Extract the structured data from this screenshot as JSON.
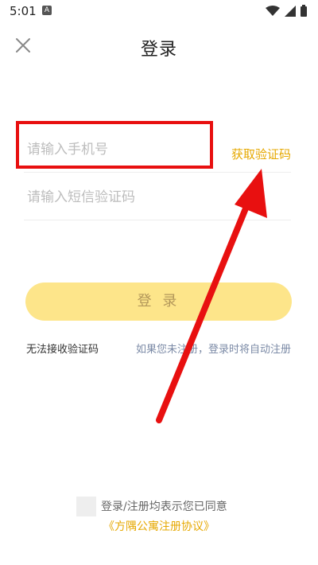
{
  "status_bar": {
    "time": "5:01",
    "notification_glyph": "A"
  },
  "header": {
    "title": "登录",
    "close_icon": "close-icon"
  },
  "phone_field": {
    "placeholder": "请输入手机号",
    "value": ""
  },
  "get_code_label": "获取验证码",
  "sms_field": {
    "placeholder": "请输入短信验证码",
    "value": ""
  },
  "login_button": {
    "label": "登 录"
  },
  "cant_receive_label": "无法接收验证码",
  "auto_register_note": "如果您未注册，登录时将自动注册",
  "agreement": {
    "text": "登录/注册均表示您已同意",
    "link": "《方隅公寓注册协议》"
  },
  "colors": {
    "accent": "#e6a800",
    "button_bg": "#fde58a",
    "annotation_red": "#e81010"
  }
}
